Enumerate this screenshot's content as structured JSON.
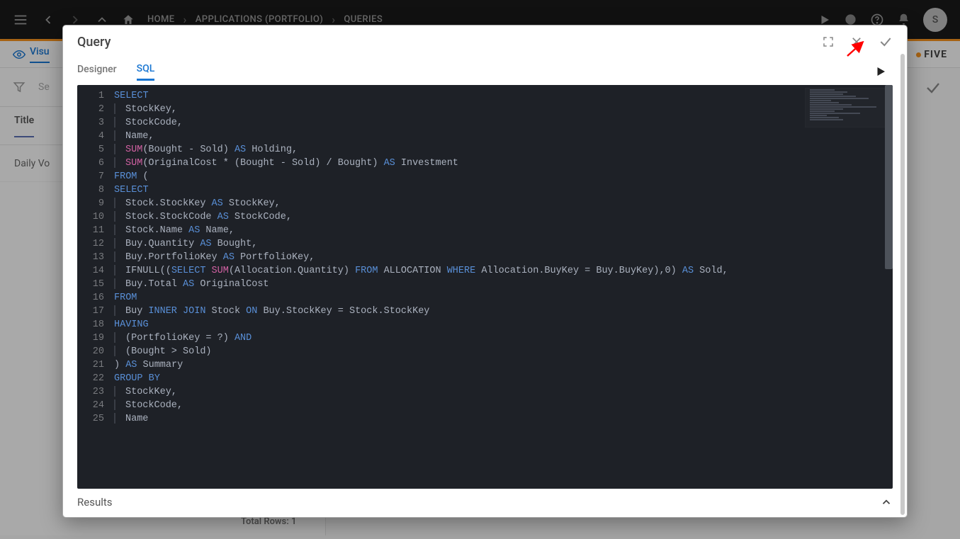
{
  "topbar": {
    "home": "HOME",
    "crumb1": "APPLICATIONS (PORTFOLIO)",
    "crumb2": "QUERIES",
    "avatar_initial": "S"
  },
  "brand": {
    "name": "FIVE"
  },
  "toolrow": {
    "visu_label": "Visu"
  },
  "filterbar": {
    "search_placeholder": "Se"
  },
  "table": {
    "header_title": "Title",
    "row1": "Daily Vo",
    "total_rows_label": "Total Rows: 1"
  },
  "modal": {
    "title": "Query",
    "tabs": {
      "designer": "Designer",
      "sql": "SQL"
    },
    "results_label": "Results"
  },
  "code": {
    "lines": [
      [
        {
          "t": "SELECT",
          "c": "kw"
        }
      ],
      [
        {
          "t": "    StockKey,",
          "c": "tk",
          "g": 1
        }
      ],
      [
        {
          "t": "    StockCode,",
          "c": "tk",
          "g": 1
        }
      ],
      [
        {
          "t": "    Name,",
          "c": "tk",
          "g": 1
        }
      ],
      [
        {
          "t": "    ",
          "c": "tk",
          "g": 1
        },
        {
          "t": "SUM",
          "c": "fn"
        },
        {
          "t": "(Bought - Sold) ",
          "c": "tk"
        },
        {
          "t": "AS",
          "c": "kw"
        },
        {
          "t": " Holding,",
          "c": "tk"
        }
      ],
      [
        {
          "t": "    ",
          "c": "tk",
          "g": 1
        },
        {
          "t": "SUM",
          "c": "fn"
        },
        {
          "t": "(OriginalCost * (Bought - Sold) / Bought) ",
          "c": "tk"
        },
        {
          "t": "AS",
          "c": "kw"
        },
        {
          "t": " Investment",
          "c": "tk"
        }
      ],
      [
        {
          "t": "FROM",
          "c": "kw"
        },
        {
          "t": " (",
          "c": "tk"
        }
      ],
      [
        {
          "t": "SELECT",
          "c": "kw"
        }
      ],
      [
        {
          "t": "    Stock.StockKey ",
          "c": "tk",
          "g": 1
        },
        {
          "t": "AS",
          "c": "kw"
        },
        {
          "t": " StockKey,",
          "c": "tk"
        }
      ],
      [
        {
          "t": "    Stock.StockCode ",
          "c": "tk",
          "g": 1
        },
        {
          "t": "AS",
          "c": "kw"
        },
        {
          "t": " StockCode,",
          "c": "tk"
        }
      ],
      [
        {
          "t": "    Stock.Name ",
          "c": "tk",
          "g": 1
        },
        {
          "t": "AS",
          "c": "kw"
        },
        {
          "t": " Name,",
          "c": "tk"
        }
      ],
      [
        {
          "t": "    Buy.Quantity ",
          "c": "tk",
          "g": 1
        },
        {
          "t": "AS",
          "c": "kw"
        },
        {
          "t": " Bought,",
          "c": "tk"
        }
      ],
      [
        {
          "t": "    Buy.PortfolioKey ",
          "c": "tk",
          "g": 1
        },
        {
          "t": "AS",
          "c": "kw"
        },
        {
          "t": " PortfolioKey,",
          "c": "tk"
        }
      ],
      [
        {
          "t": "    IFNULL((",
          "c": "tk",
          "g": 1
        },
        {
          "t": "SELECT",
          "c": "kw"
        },
        {
          "t": " ",
          "c": "tk"
        },
        {
          "t": "SUM",
          "c": "fn"
        },
        {
          "t": "(Allocation.Quantity) ",
          "c": "tk"
        },
        {
          "t": "FROM",
          "c": "kw"
        },
        {
          "t": " ALLOCATION ",
          "c": "tk"
        },
        {
          "t": "WHERE",
          "c": "kw"
        },
        {
          "t": " Allocation.BuyKey = Buy.BuyKey),0) ",
          "c": "tk"
        },
        {
          "t": "AS",
          "c": "kw"
        },
        {
          "t": " Sold,",
          "c": "tk"
        }
      ],
      [
        {
          "t": "    Buy.Total ",
          "c": "tk",
          "g": 1
        },
        {
          "t": "AS",
          "c": "kw"
        },
        {
          "t": " OriginalCost",
          "c": "tk"
        }
      ],
      [
        {
          "t": "FROM",
          "c": "kw"
        }
      ],
      [
        {
          "t": "    Buy ",
          "c": "tk",
          "g": 1
        },
        {
          "t": "INNER",
          "c": "kw"
        },
        {
          "t": " ",
          "c": "tk"
        },
        {
          "t": "JOIN",
          "c": "kw"
        },
        {
          "t": " Stock ",
          "c": "tk"
        },
        {
          "t": "ON",
          "c": "kw"
        },
        {
          "t": " Buy.StockKey = Stock.StockKey",
          "c": "tk"
        }
      ],
      [
        {
          "t": "HAVING",
          "c": "kw"
        }
      ],
      [
        {
          "t": "    (PortfolioKey = ?) ",
          "c": "tk",
          "g": 1
        },
        {
          "t": "AND",
          "c": "kw"
        }
      ],
      [
        {
          "t": "    (Bought > Sold)",
          "c": "tk",
          "g": 1
        }
      ],
      [
        {
          "t": ") ",
          "c": "tk"
        },
        {
          "t": "AS",
          "c": "kw"
        },
        {
          "t": " Summary",
          "c": "tk"
        }
      ],
      [
        {
          "t": "GROUP",
          "c": "kw"
        },
        {
          "t": " ",
          "c": "tk"
        },
        {
          "t": "BY",
          "c": "kw"
        }
      ],
      [
        {
          "t": "    StockKey,",
          "c": "tk",
          "g": 1
        }
      ],
      [
        {
          "t": "    StockCode,",
          "c": "tk",
          "g": 1
        }
      ],
      [
        {
          "t": "    Name",
          "c": "tk",
          "g": 1
        }
      ]
    ]
  }
}
